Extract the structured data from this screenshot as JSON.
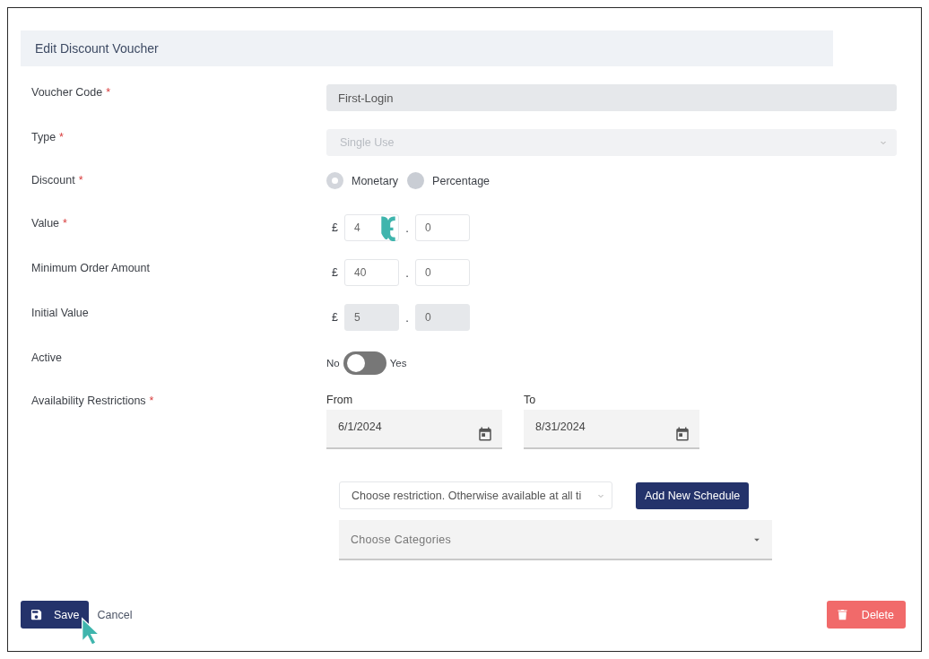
{
  "header": {
    "title": "Edit Discount Voucher"
  },
  "fields": [
    {
      "kind": "text",
      "label": "Voucher Code",
      "required_mark": "*",
      "value": "First-Login",
      "disabled": true
    },
    {
      "kind": "select",
      "label": "Type",
      "required_mark": "*",
      "value": "Single Use",
      "disabled": true
    },
    {
      "kind": "radio",
      "label": "Discount",
      "required_mark": "*",
      "options": [
        {
          "label": "Monetary",
          "selected": true
        },
        {
          "label": "Percentage",
          "selected": false
        }
      ]
    },
    {
      "kind": "money",
      "label": "Value",
      "required_mark": "*",
      "currency": "£",
      "pounds": "4",
      "separator": ".",
      "pence": "0",
      "disabled": false
    },
    {
      "kind": "money",
      "label": "Minimum Order Amount",
      "currency": "£",
      "pounds": "40",
      "separator": ".",
      "pence": "0",
      "disabled": false
    },
    {
      "kind": "money",
      "label": "Initial Value",
      "currency": "£",
      "pounds": "5",
      "separator": ".",
      "pence": "0",
      "disabled": true
    },
    {
      "kind": "toggle",
      "label": "Active",
      "off_label": "No",
      "on_label": "Yes",
      "on": false
    },
    {
      "kind": "daterange",
      "label": "Availability Restrictions",
      "required_mark": "*",
      "from_label": "From",
      "from_value": "6/1/2024",
      "to_label": "To",
      "to_value": "8/31/2024"
    }
  ],
  "restriction": {
    "select_value": "Choose restriction. Otherwise available at all ti",
    "button": "Add New Schedule"
  },
  "categories": {
    "placeholder": "Choose Categories"
  },
  "footer": {
    "save": "Save",
    "cancel": "Cancel",
    "delete": "Delete"
  }
}
